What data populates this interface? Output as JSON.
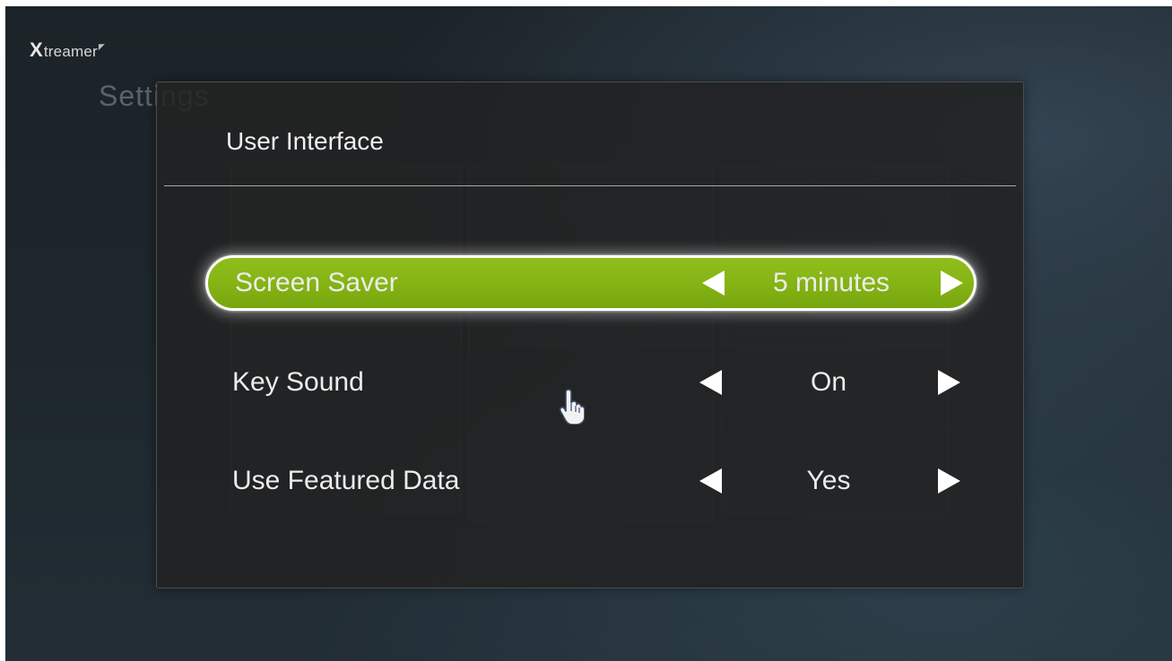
{
  "brand": {
    "logo_x": "X",
    "logo_text": "treamer"
  },
  "background": {
    "page_title": "Settings"
  },
  "dialog": {
    "title": "User Interface",
    "settings": [
      {
        "label": "Screen Saver",
        "value": "5 minutes",
        "selected": true
      },
      {
        "label": "Key Sound",
        "value": "On",
        "selected": false
      },
      {
        "label": "Use Featured Data",
        "value": "Yes",
        "selected": false
      }
    ]
  },
  "colors": {
    "selected_row": "#84b314",
    "dialog_bg": "#222222",
    "text": "#ececec"
  },
  "icons": {
    "left": "triangle-left-icon",
    "right": "triangle-right-icon",
    "pointer": "hand-pointer-icon"
  }
}
